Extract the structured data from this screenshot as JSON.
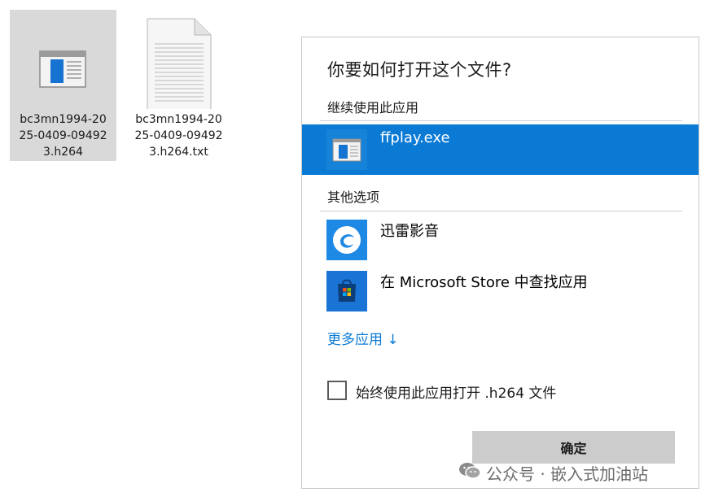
{
  "desktop": {
    "files": [
      {
        "name_lines": [
          "bc3mn1994-20",
          "25-0409-09492",
          "3.h264"
        ],
        "icon": "video-file-icon",
        "selected": true
      },
      {
        "name_lines": [
          "bc3mn1994-20",
          "25-0409-09492",
          "3.h264.txt"
        ],
        "icon": "text-file-icon",
        "selected": false
      }
    ]
  },
  "dialog": {
    "title": "你要如何打开这个文件?",
    "continue_section_label": "继续使用此应用",
    "current_app": {
      "name": "ffplay.exe",
      "icon": "app-window-icon",
      "selected": true
    },
    "other_section_label": "其他选项",
    "other_apps": [
      {
        "name": "迅雷影音",
        "icon": "xunlei-player-icon"
      },
      {
        "name": "在 Microsoft Store 中查找应用",
        "icon": "store-bag-icon"
      }
    ],
    "more_apps_link": "更多应用 ↓",
    "always_use_checkbox": {
      "label": "始终使用此应用打开 .h264 文件",
      "checked": false
    },
    "ok_button": "确定"
  },
  "watermark": {
    "text": "公众号 · 嵌入式加油站",
    "icon": "wechat-icon"
  },
  "colors": {
    "accent": "#0a7ad5",
    "selected_file_bg": "#d9d9d9",
    "button_bg": "#cccccc"
  }
}
